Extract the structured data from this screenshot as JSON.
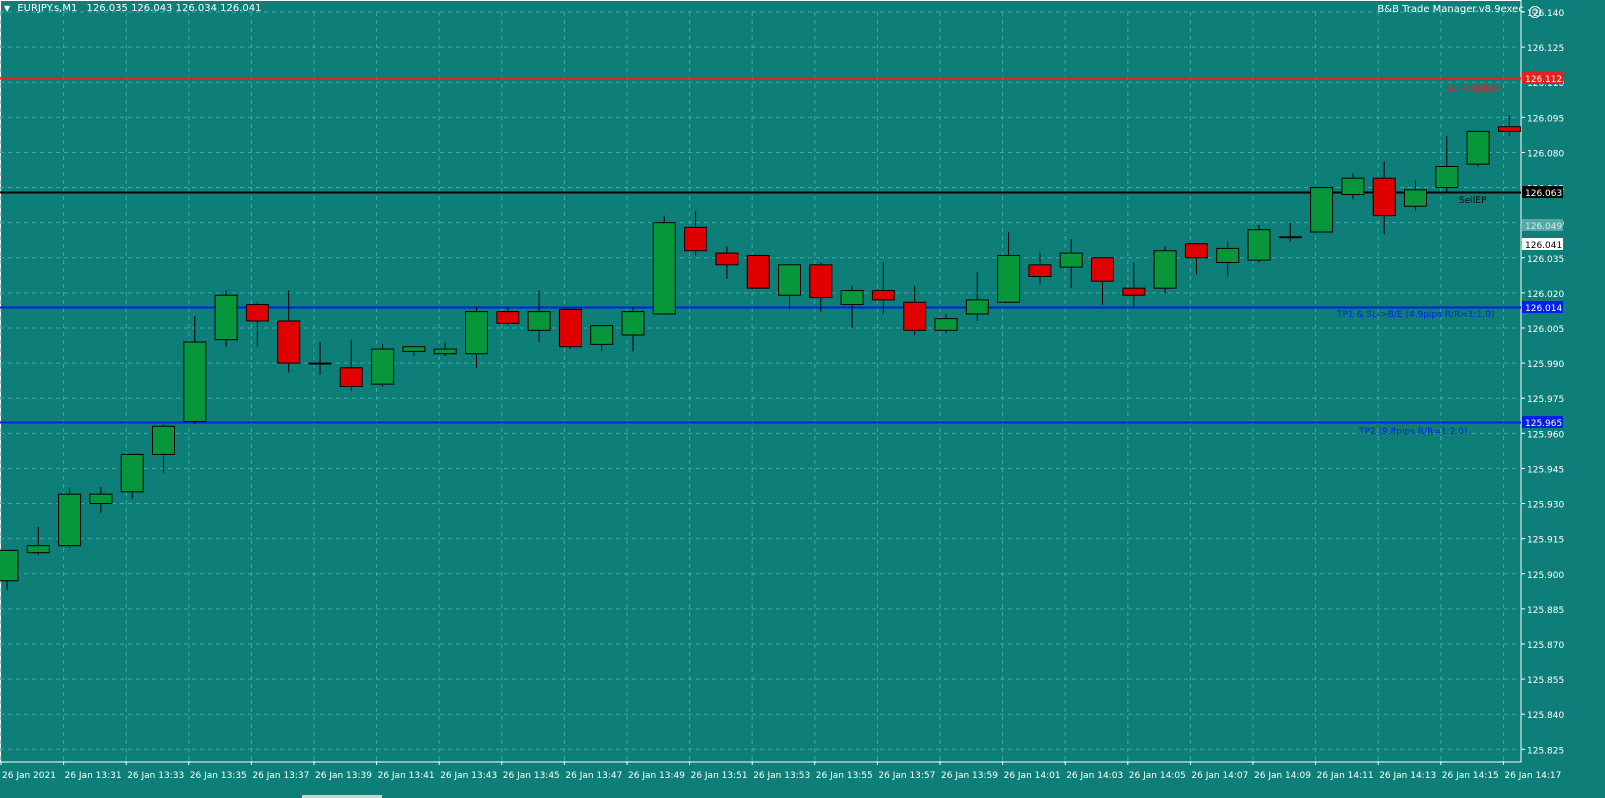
{
  "header": {
    "symbol": "EURJPY.s,M1",
    "ohlc": "126.035 126.043 126.034 126.041"
  },
  "expert_label": "B&B Trade Manager.v8.9exec",
  "colors": {
    "background": "#0e7f78",
    "grid": "#3fa89f",
    "bull": "#08963a",
    "bear": "#e00000",
    "wick": "#000000",
    "sl_line": "#e61f1f",
    "entry_line": "#000000",
    "tp_line": "#0020e8",
    "axis_text": "#ffffff"
  },
  "price_axis": {
    "min": 125.82,
    "max": 126.14,
    "ticks": [
      "126.140",
      "126.125",
      "126.110",
      "126.095",
      "126.080",
      "126.065",
      "126.050",
      "126.035",
      "126.020",
      "126.005",
      "125.990",
      "125.975",
      "125.960",
      "125.945",
      "125.930",
      "125.915",
      "125.900",
      "125.885",
      "125.870",
      "125.855",
      "125.840",
      "125.825"
    ]
  },
  "time_axis": {
    "labels": [
      "26 Jan 2021",
      "26 Jan 13:31",
      "26 Jan 13:33",
      "26 Jan 13:35",
      "26 Jan 13:37",
      "26 Jan 13:39",
      "26 Jan 13:41",
      "26 Jan 13:43",
      "26 Jan 13:45",
      "26 Jan 13:47",
      "26 Jan 13:49",
      "26 Jan 13:51",
      "26 Jan 13:53",
      "26 Jan 13:55",
      "26 Jan 13:57",
      "26 Jan 13:59",
      "26 Jan 14:01",
      "26 Jan 14:03",
      "26 Jan 14:05",
      "26 Jan 14:07",
      "26 Jan 14:09",
      "26 Jan 14:11",
      "26 Jan 14:13",
      "26 Jan 14:15",
      "26 Jan 14:17"
    ]
  },
  "trade_lines": [
    {
      "name": "sl-line",
      "price": 126.112,
      "tag": "126.112",
      "color": "#e61f1f",
      "label": "SL (4.9pips)"
    },
    {
      "name": "sell-entry-line",
      "price": 126.063,
      "tag": "126.063",
      "color": "#000000",
      "label": "SellEP"
    },
    {
      "name": "tp1-line",
      "price": 126.014,
      "tag": "126.014",
      "color": "#0020e8",
      "label": "TP1 & SL->B/E (4.9pips R/R=1:1.0)"
    },
    {
      "name": "tp2-line",
      "price": 125.965,
      "tag": "125.965",
      "color": "#0020e8",
      "label": "TP2 (9.8pips R/R=1:2.0)"
    }
  ],
  "price_tags": [
    {
      "name": "ask-price-tag",
      "price": 126.049,
      "text": "126.049"
    },
    {
      "name": "bid-price-tag",
      "price": 126.041,
      "text": "126.041"
    }
  ],
  "chart_data": {
    "type": "candlestick",
    "candles": [
      {
        "o": 125.897,
        "h": 125.907,
        "l": 125.893,
        "c": 125.91
      },
      {
        "o": 125.909,
        "h": 125.92,
        "l": 125.908,
        "c": 125.912
      },
      {
        "o": 125.912,
        "h": 125.937,
        "l": 125.911,
        "c": 125.934
      },
      {
        "o": 125.93,
        "h": 125.937,
        "l": 125.926,
        "c": 125.934
      },
      {
        "o": 125.935,
        "h": 125.951,
        "l": 125.932,
        "c": 125.951
      },
      {
        "o": 125.951,
        "h": 125.964,
        "l": 125.943,
        "c": 125.963
      },
      {
        "o": 125.965,
        "h": 126.01,
        "l": 125.964,
        "c": 125.999
      },
      {
        "o": 126.0,
        "h": 126.021,
        "l": 125.997,
        "c": 126.019
      },
      {
        "o": 126.015,
        "h": 126.016,
        "l": 125.997,
        "c": 126.008
      },
      {
        "o": 126.008,
        "h": 126.021,
        "l": 125.986,
        "c": 125.99
      },
      {
        "o": 125.99,
        "h": 125.999,
        "l": 125.985,
        "c": 125.99
      },
      {
        "o": 125.988,
        "h": 126.0,
        "l": 125.978,
        "c": 125.98
      },
      {
        "o": 125.981,
        "h": 125.998,
        "l": 125.98,
        "c": 125.996
      },
      {
        "o": 125.995,
        "h": 125.997,
        "l": 125.993,
        "c": 125.997
      },
      {
        "o": 125.994,
        "h": 125.999,
        "l": 125.993,
        "c": 125.996
      },
      {
        "o": 125.994,
        "h": 126.014,
        "l": 125.988,
        "c": 126.012
      },
      {
        "o": 126.012,
        "h": 126.014,
        "l": 126.006,
        "c": 126.007
      },
      {
        "o": 126.004,
        "h": 126.021,
        "l": 125.999,
        "c": 126.012
      },
      {
        "o": 126.013,
        "h": 126.013,
        "l": 125.996,
        "c": 125.997
      },
      {
        "o": 125.998,
        "h": 126.003,
        "l": 125.995,
        "c": 126.006
      },
      {
        "o": 126.002,
        "h": 126.014,
        "l": 125.995,
        "c": 126.012
      },
      {
        "o": 126.011,
        "h": 126.053,
        "l": 126.011,
        "c": 126.05
      },
      {
        "o": 126.048,
        "h": 126.055,
        "l": 126.036,
        "c": 126.038
      },
      {
        "o": 126.037,
        "h": 126.04,
        "l": 126.026,
        "c": 126.032
      },
      {
        "o": 126.036,
        "h": 126.036,
        "l": 126.022,
        "c": 126.022
      },
      {
        "o": 126.019,
        "h": 126.032,
        "l": 126.013,
        "c": 126.032
      },
      {
        "o": 126.032,
        "h": 126.033,
        "l": 126.012,
        "c": 126.018
      },
      {
        "o": 126.015,
        "h": 126.023,
        "l": 126.005,
        "c": 126.021
      },
      {
        "o": 126.021,
        "h": 126.033,
        "l": 126.011,
        "c": 126.017
      },
      {
        "o": 126.016,
        "h": 126.023,
        "l": 126.002,
        "c": 126.004
      },
      {
        "o": 126.004,
        "h": 126.011,
        "l": 126.003,
        "c": 126.009
      },
      {
        "o": 126.011,
        "h": 126.029,
        "l": 126.008,
        "c": 126.017
      },
      {
        "o": 126.016,
        "h": 126.046,
        "l": 126.016,
        "c": 126.036
      },
      {
        "o": 126.032,
        "h": 126.037,
        "l": 126.024,
        "c": 126.027
      },
      {
        "o": 126.031,
        "h": 126.043,
        "l": 126.022,
        "c": 126.037
      },
      {
        "o": 126.035,
        "h": 126.035,
        "l": 126.015,
        "c": 126.025
      },
      {
        "o": 126.022,
        "h": 126.033,
        "l": 126.014,
        "c": 126.019
      },
      {
        "o": 126.022,
        "h": 126.04,
        "l": 126.02,
        "c": 126.038
      },
      {
        "o": 126.041,
        "h": 126.041,
        "l": 126.028,
        "c": 126.035
      },
      {
        "o": 126.033,
        "h": 126.042,
        "l": 126.027,
        "c": 126.039
      },
      {
        "o": 126.034,
        "h": 126.049,
        "l": 126.033,
        "c": 126.047
      },
      {
        "o": 126.044,
        "h": 126.05,
        "l": 126.042,
        "c": 126.044
      },
      {
        "o": 126.046,
        "h": 126.065,
        "l": 126.046,
        "c": 126.065
      },
      {
        "o": 126.062,
        "h": 126.071,
        "l": 126.06,
        "c": 126.069
      },
      {
        "o": 126.069,
        "h": 126.076,
        "l": 126.045,
        "c": 126.053
      },
      {
        "o": 126.057,
        "h": 126.068,
        "l": 126.055,
        "c": 126.064
      },
      {
        "o": 126.065,
        "h": 126.087,
        "l": 126.063,
        "c": 126.074
      },
      {
        "o": 126.075,
        "h": 126.086,
        "l": 126.074,
        "c": 126.089
      },
      {
        "o": 126.091,
        "h": 126.096,
        "l": 126.087,
        "c": 126.089
      }
    ]
  }
}
